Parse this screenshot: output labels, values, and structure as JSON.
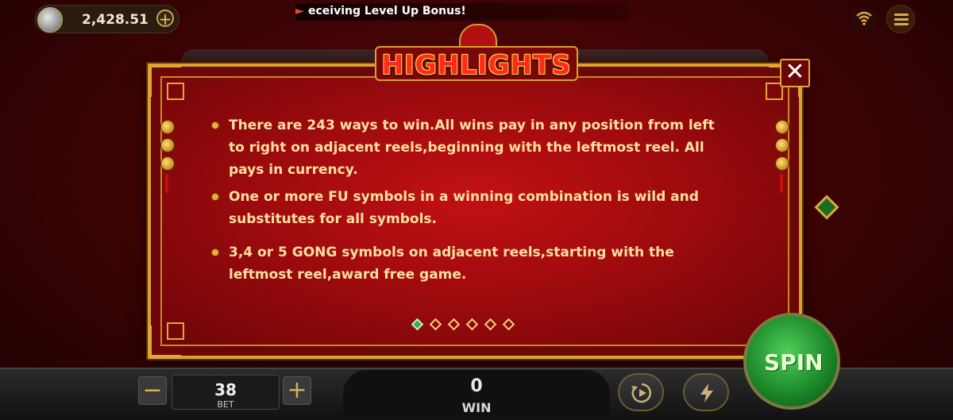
{
  "header": {
    "balance": "2,428.51",
    "ticker": "eceiving Level Up Bonus!"
  },
  "modal": {
    "title": "HIGHLIGHTS",
    "close": "✕",
    "rules": [
      "There are 243 ways to win.All wins pay in any position from left to right on adjacent reels,beginning with the leftmost reel. All pays in currency.",
      "One or more FU symbols in a winning combination is wild and substitutes for all symbols.",
      "3,4 or 5 GONG symbols on adjacent reels,starting with the leftmost reel,award free game."
    ],
    "pager": {
      "total": 6,
      "current": 1
    }
  },
  "footer": {
    "bet_value": "38",
    "bet_label": "BET",
    "win_value": "0",
    "win_label": "WIN",
    "spin_label": "SPIN"
  },
  "colors": {
    "accent_gold": "#d9a12e",
    "modal_red": "#a00b0e",
    "spin_green": "#1d8a2a"
  }
}
